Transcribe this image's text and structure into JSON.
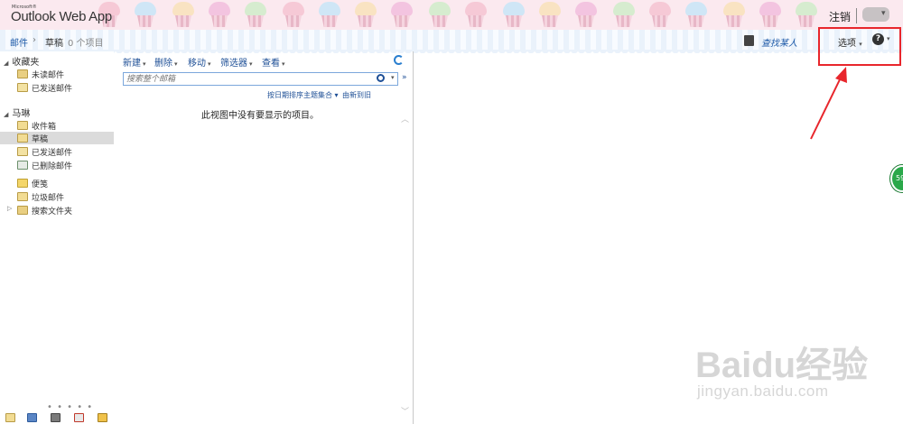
{
  "banner": {
    "logo_small": "Microsoft®",
    "app_title": "Outlook Web App",
    "sign_out": "注销",
    "user_caret": "▾"
  },
  "nav": {
    "breadcrumb_mail": "邮件",
    "breadcrumb_sep": "›",
    "current_folder": "草稿",
    "item_count": "0 个项目",
    "find_someone": "查找某人",
    "options": "选项",
    "options_caret": "▾",
    "help_glyph": "?",
    "help_caret": "▾"
  },
  "sidebar": {
    "favorites_header": "收藏夹",
    "favorites": [
      {
        "label": "未读邮件",
        "icon": "search-folder-icon"
      },
      {
        "label": "已发送邮件",
        "icon": "sent-folder-icon"
      }
    ],
    "mailbox_header": "马琳",
    "folders": [
      {
        "label": "收件箱",
        "icon": "inbox-icon"
      },
      {
        "label": "草稿",
        "icon": "drafts-icon",
        "selected": true
      },
      {
        "label": "已发送邮件",
        "icon": "sent-folder-icon"
      },
      {
        "label": "已删除邮件",
        "icon": "deleted-folder-icon"
      },
      {
        "label": "便笺",
        "icon": "notes-icon"
      },
      {
        "label": "垃圾邮件",
        "icon": "junk-folder-icon"
      },
      {
        "label": "搜索文件夹",
        "icon": "search-folder-icon"
      }
    ],
    "bottom_dots": "• • • • •"
  },
  "list": {
    "toolbar": [
      "新建",
      "删除",
      "移动",
      "筛选器",
      "查看"
    ],
    "dropdown_caret": "▾",
    "search_placeholder": "搜索整个邮箱",
    "expand_glyph": "»",
    "sort_label": "按日期排序主题集合 ▾",
    "newest_label": "由新到旧",
    "empty_message": "此视图中没有要显示的项目。",
    "scroll_up": "︿",
    "scroll_down": "﹀"
  },
  "badge": {
    "text": "59"
  },
  "watermark": {
    "text": "Baidu经验",
    "sub": "jingyan.baidu.com"
  },
  "colors": {
    "highlight_box": "#e8262c",
    "link": "#1e4f96",
    "selected_row": "#dbdbdb"
  }
}
